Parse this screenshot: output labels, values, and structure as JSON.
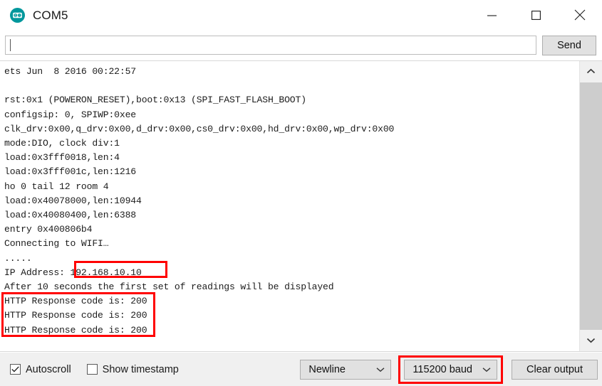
{
  "window": {
    "title": "COM5",
    "icon": "arduino-logo-icon",
    "controls": {
      "minimize": "minimize-icon",
      "maximize": "maximize-icon",
      "close": "close-icon"
    }
  },
  "send_row": {
    "input_value": "",
    "input_placeholder": "",
    "send_label": "Send"
  },
  "console": {
    "lines": [
      "ets Jun  8 2016 00:22:57",
      "",
      "rst:0x1 (POWERON_RESET),boot:0x13 (SPI_FAST_FLASH_BOOT)",
      "configsip: 0, SPIWP:0xee",
      "clk_drv:0x00,q_drv:0x00,d_drv:0x00,cs0_drv:0x00,hd_drv:0x00,wp_drv:0x00",
      "mode:DIO, clock div:1",
      "load:0x3fff0018,len:4",
      "load:0x3fff001c,len:1216",
      "ho 0 tail 12 room 4",
      "load:0x40078000,len:10944",
      "load:0x40080400,len:6388",
      "entry 0x400806b4",
      "Connecting to WIFI…",
      ".....",
      "IP Address: 192.168.10.10",
      "After 10 seconds the first set of readings will be displayed",
      "HTTP Response code is: 200",
      "HTTP Response code is: 200",
      "HTTP Response code is: 200"
    ],
    "ip_address": "192.168.10.10",
    "http_response_code": "200"
  },
  "scrollbar": {
    "up_arrow": "chevron-up-icon",
    "down_arrow": "chevron-down-icon",
    "thumb_position": "full"
  },
  "bottom_bar": {
    "autoscroll": {
      "label": "Autoscroll",
      "checked": true
    },
    "show_timestamp": {
      "label": "Show timestamp",
      "checked": false
    },
    "line_ending": {
      "selected": "Newline"
    },
    "baud_rate": {
      "selected": "115200 baud"
    },
    "clear_output_label": "Clear output"
  },
  "annotations": {
    "ip_box": {
      "color": "#ff0000",
      "target": "192.168.10.10"
    },
    "http_box": {
      "color": "#ff0000",
      "target": "HTTP Response code is: 200"
    },
    "baud_box": {
      "color": "#ff0000",
      "target": "115200 baud"
    }
  }
}
